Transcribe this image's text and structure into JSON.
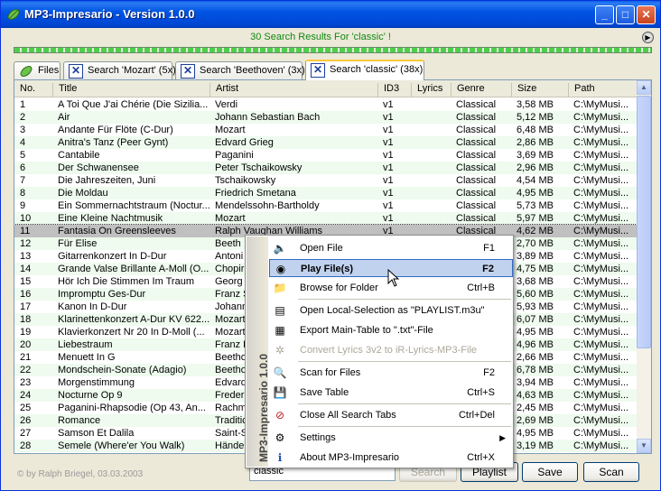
{
  "window": {
    "title": "MP3-Impresario - Version 1.0.0"
  },
  "status": {
    "text": "30 Search Results For 'classic' !"
  },
  "tabs": [
    {
      "label": "Files",
      "icon": "leaf-icon"
    },
    {
      "label": "Search 'Mozart' (5x)",
      "icon": "close-box-icon"
    },
    {
      "label": "Search 'Beethoven' (3x)",
      "icon": "close-box-icon"
    },
    {
      "label": "Search 'classic' (38x)",
      "icon": "close-box-icon"
    }
  ],
  "columns": [
    "No.",
    "Title",
    "Artist",
    "ID3",
    "Lyrics",
    "Genre",
    "Size",
    "Path"
  ],
  "rows": [
    [
      "1",
      "A Toi Que J'ai Chérie (Die Sizilia...",
      "Verdi",
      "v1",
      "",
      "Classical",
      "3,58 MB",
      "C:\\MyMusi..."
    ],
    [
      "2",
      "Air",
      "Johann Sebastian Bach",
      "v1",
      "",
      "Classical",
      "5,12 MB",
      "C:\\MyMusi..."
    ],
    [
      "3",
      "Andante Für Flöte (C-Dur)",
      "Mozart",
      "v1",
      "",
      "Classical",
      "6,48 MB",
      "C:\\MyMusi..."
    ],
    [
      "4",
      "Anitra's Tanz (Peer Gynt)",
      "Edvard Grieg",
      "v1",
      "",
      "Classical",
      "2,86 MB",
      "C:\\MyMusi..."
    ],
    [
      "5",
      "Cantabile",
      "Paganini",
      "v1",
      "",
      "Classical",
      "3,69 MB",
      "C:\\MyMusi..."
    ],
    [
      "6",
      "Der Schwanensee",
      "Peter Tschaikowsky",
      "v1",
      "",
      "Classical",
      "2,96 MB",
      "C:\\MyMusi..."
    ],
    [
      "7",
      "Die Jahreszeiten, Juni",
      "Tschaikowsky",
      "v1",
      "",
      "Classical",
      "4,54 MB",
      "C:\\MyMusi..."
    ],
    [
      "8",
      "Die Moldau",
      "Friedrich Smetana",
      "v1",
      "",
      "Classical",
      "4,95 MB",
      "C:\\MyMusi..."
    ],
    [
      "9",
      "Ein Sommernachtstraum (Noctur...",
      "Mendelssohn-Bartholdy",
      "v1",
      "",
      "Classical",
      "5,73 MB",
      "C:\\MyMusi..."
    ],
    [
      "10",
      "Eine Kleine Nachtmusik",
      "Mozart",
      "v1",
      "",
      "Classical",
      "5,97 MB",
      "C:\\MyMusi..."
    ],
    [
      "11",
      "Fantasia On Greensleeves",
      "Ralph Vaughan Williams",
      "v1",
      "",
      "Classical",
      "4,62 MB",
      "C:\\MyMusi..."
    ],
    [
      "12",
      "Für Elise",
      "Beeth",
      "",
      "",
      "",
      "2,70 MB",
      "C:\\MyMusi..."
    ],
    [
      "13",
      "Gitarrenkonzert In D-Dur",
      "Antoni",
      "",
      "",
      "",
      "3,89 MB",
      "C:\\MyMusi..."
    ],
    [
      "14",
      "Grande Valse Brillante A-Moll (O...",
      "Chopir",
      "",
      "",
      "",
      "4,75 MB",
      "C:\\MyMusi..."
    ],
    [
      "15",
      "Hör Ich Die Stimmen Im Traum",
      "Georg",
      "",
      "",
      "",
      "3,68 MB",
      "C:\\MyMusi..."
    ],
    [
      "16",
      "Impromptu Ges-Dur",
      "Franz S",
      "",
      "",
      "",
      "5,60 MB",
      "C:\\MyMusi..."
    ],
    [
      "17",
      "Kanon In D-Dur",
      "Johann",
      "",
      "",
      "",
      "5,93 MB",
      "C:\\MyMusi..."
    ],
    [
      "18",
      "Klarinettenkonzert A-Dur KV 622...",
      "Mozart",
      "",
      "",
      "",
      "6,07 MB",
      "C:\\MyMusi..."
    ],
    [
      "19",
      "Klavierkonzert Nr 20 In D-Moll (...",
      "Mozart",
      "",
      "",
      "",
      "4,95 MB",
      "C:\\MyMusi..."
    ],
    [
      "20",
      "Liebestraum",
      "Franz L",
      "",
      "",
      "",
      "4,96 MB",
      "C:\\MyMusi..."
    ],
    [
      "21",
      "Menuett In G",
      "Beetho",
      "",
      "",
      "",
      "2,66 MB",
      "C:\\MyMusi..."
    ],
    [
      "22",
      "Mondschein-Sonate (Adagio)",
      "Beetho",
      "",
      "",
      "",
      "6,78 MB",
      "C:\\MyMusi..."
    ],
    [
      "23",
      "Morgenstimmung",
      "Edvard",
      "",
      "",
      "",
      "3,94 MB",
      "C:\\MyMusi..."
    ],
    [
      "24",
      "Nocturne Op 9",
      "Frederi",
      "",
      "",
      "",
      "4,63 MB",
      "C:\\MyMusi..."
    ],
    [
      "25",
      "Paganini-Rhapsodie (Op 43, An...",
      "Rachm",
      "",
      "",
      "",
      "2,45 MB",
      "C:\\MyMusi..."
    ],
    [
      "26",
      "Romance",
      "Traditic",
      "",
      "",
      "",
      "2,69 MB",
      "C:\\MyMusi..."
    ],
    [
      "27",
      "Samson Et Dalila",
      "Saint-S",
      "",
      "",
      "",
      "4,95 MB",
      "C:\\MyMusi..."
    ],
    [
      "28",
      "Semele (Where'er You Walk)",
      "Händel",
      "",
      "",
      "",
      "3,19 MB",
      "C:\\MyMusi..."
    ]
  ],
  "bottom": {
    "copyright": "© by Ralph Briegel, 03.03.2003",
    "search_value": "classic",
    "search_label": "Search",
    "playlist_label": "Playlist",
    "save_label": "Save",
    "scan_label": "Scan"
  },
  "context_menu": {
    "side_label": "MP3-Impresario 1.0.0",
    "items": [
      {
        "label": "Open File",
        "key": "F1",
        "icon": "speaker-icon"
      },
      {
        "label": "Play File(s)",
        "key": "F2",
        "icon": "play-icon"
      },
      {
        "label": "Browse for Folder",
        "key": "Ctrl+B",
        "icon": "folder-icon"
      },
      {
        "label": "Open Local-Selection as \"PLAYLIST.m3u\"",
        "key": "",
        "icon": "playlist-icon"
      },
      {
        "label": "Export Main-Table to \".txt\"-File",
        "key": "",
        "icon": "export-icon"
      },
      {
        "label": "Convert Lyrics 3v2 to iR-Lyrics-MP3-File",
        "key": "",
        "icon": "convert-icon"
      },
      {
        "label": "Scan for Files",
        "key": "F2",
        "icon": "magnifier-icon"
      },
      {
        "label": "Save Table",
        "key": "Ctrl+S",
        "icon": "disk-icon"
      },
      {
        "label": "Close All Search Tabs",
        "key": "Ctrl+Del",
        "icon": "no-entry-icon"
      },
      {
        "label": "Settings",
        "key": "",
        "icon": "gear-icon"
      },
      {
        "label": "About MP3-Impresario",
        "key": "Ctrl+X",
        "icon": "info-icon"
      }
    ]
  }
}
